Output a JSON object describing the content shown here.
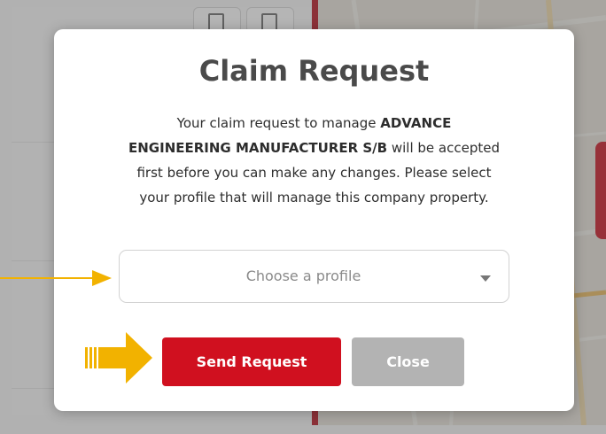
{
  "dialog": {
    "title": "Claim Request",
    "message_prefix": "Your claim request to manage ",
    "company_name": "ADVANCE ENGINEERING MANUFACTURER S/B",
    "message_suffix": " will be accepted first before you can make any changes. Please select your profile that will manage this company property.",
    "profile_select": {
      "placeholder": "Choose a profile"
    },
    "send_button_label": "Send Request",
    "close_button_label": "Close"
  },
  "colors": {
    "primary_red": "#d0101f",
    "disabled_gray": "#b3b3b3",
    "annotation_arrow": "#f2b200"
  },
  "icons": [
    "document-icon",
    "document-icon",
    "chevron-down-icon",
    "arrow-annotation-icon"
  ]
}
